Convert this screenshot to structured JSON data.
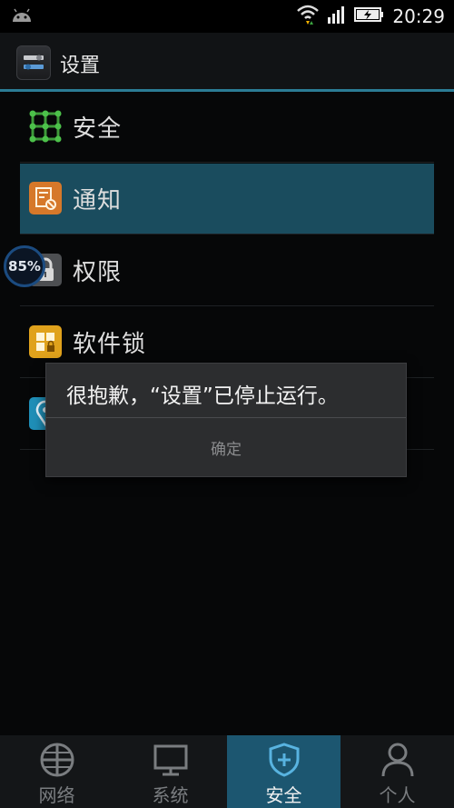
{
  "status_bar": {
    "time": "20:29"
  },
  "app": {
    "title": "设置"
  },
  "list_items": [
    {
      "label": "安全",
      "icon": "grid-dots-icon"
    },
    {
      "label": "通知",
      "icon": "notification-icon"
    },
    {
      "label": "权限",
      "icon": "lock-icon"
    },
    {
      "label": "软件锁",
      "icon": "app-lock-icon"
    }
  ],
  "floating_indicator": {
    "value": "85%"
  },
  "dialog": {
    "message": "很抱歉，“设置”已停止运行。",
    "ok_label": "确定"
  },
  "bottom_nav": {
    "tabs": [
      {
        "label": "网络",
        "icon": "globe-icon",
        "active": false
      },
      {
        "label": "系统",
        "icon": "monitor-icon",
        "active": false
      },
      {
        "label": "安全",
        "icon": "shield-icon",
        "active": true
      },
      {
        "label": "个人",
        "icon": "person-icon",
        "active": false
      }
    ]
  },
  "colors": {
    "accent": "#2b7c95",
    "selected_row": "#1a4c5e",
    "active_tab": "#1c5670"
  }
}
